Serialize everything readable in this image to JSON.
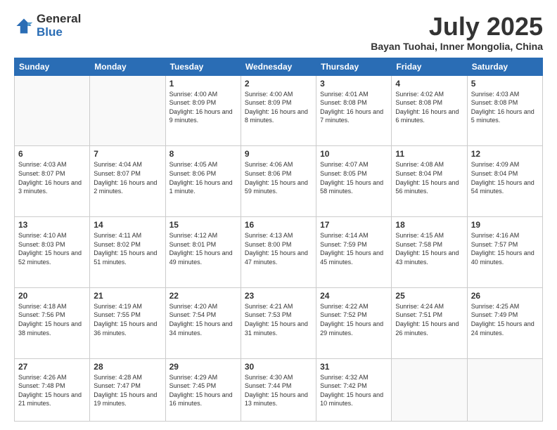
{
  "logo": {
    "general": "General",
    "blue": "Blue"
  },
  "header": {
    "title": "July 2025",
    "subtitle": "Bayan Tuohai, Inner Mongolia, China"
  },
  "weekdays": [
    "Sunday",
    "Monday",
    "Tuesday",
    "Wednesday",
    "Thursday",
    "Friday",
    "Saturday"
  ],
  "weeks": [
    [
      {
        "day": "",
        "info": ""
      },
      {
        "day": "",
        "info": ""
      },
      {
        "day": "1",
        "info": "Sunrise: 4:00 AM\nSunset: 8:09 PM\nDaylight: 16 hours\nand 9 minutes."
      },
      {
        "day": "2",
        "info": "Sunrise: 4:00 AM\nSunset: 8:09 PM\nDaylight: 16 hours\nand 8 minutes."
      },
      {
        "day": "3",
        "info": "Sunrise: 4:01 AM\nSunset: 8:08 PM\nDaylight: 16 hours\nand 7 minutes."
      },
      {
        "day": "4",
        "info": "Sunrise: 4:02 AM\nSunset: 8:08 PM\nDaylight: 16 hours\nand 6 minutes."
      },
      {
        "day": "5",
        "info": "Sunrise: 4:03 AM\nSunset: 8:08 PM\nDaylight: 16 hours\nand 5 minutes."
      }
    ],
    [
      {
        "day": "6",
        "info": "Sunrise: 4:03 AM\nSunset: 8:07 PM\nDaylight: 16 hours\nand 3 minutes."
      },
      {
        "day": "7",
        "info": "Sunrise: 4:04 AM\nSunset: 8:07 PM\nDaylight: 16 hours\nand 2 minutes."
      },
      {
        "day": "8",
        "info": "Sunrise: 4:05 AM\nSunset: 8:06 PM\nDaylight: 16 hours\nand 1 minute."
      },
      {
        "day": "9",
        "info": "Sunrise: 4:06 AM\nSunset: 8:06 PM\nDaylight: 15 hours\nand 59 minutes."
      },
      {
        "day": "10",
        "info": "Sunrise: 4:07 AM\nSunset: 8:05 PM\nDaylight: 15 hours\nand 58 minutes."
      },
      {
        "day": "11",
        "info": "Sunrise: 4:08 AM\nSunset: 8:04 PM\nDaylight: 15 hours\nand 56 minutes."
      },
      {
        "day": "12",
        "info": "Sunrise: 4:09 AM\nSunset: 8:04 PM\nDaylight: 15 hours\nand 54 minutes."
      }
    ],
    [
      {
        "day": "13",
        "info": "Sunrise: 4:10 AM\nSunset: 8:03 PM\nDaylight: 15 hours\nand 52 minutes."
      },
      {
        "day": "14",
        "info": "Sunrise: 4:11 AM\nSunset: 8:02 PM\nDaylight: 15 hours\nand 51 minutes."
      },
      {
        "day": "15",
        "info": "Sunrise: 4:12 AM\nSunset: 8:01 PM\nDaylight: 15 hours\nand 49 minutes."
      },
      {
        "day": "16",
        "info": "Sunrise: 4:13 AM\nSunset: 8:00 PM\nDaylight: 15 hours\nand 47 minutes."
      },
      {
        "day": "17",
        "info": "Sunrise: 4:14 AM\nSunset: 7:59 PM\nDaylight: 15 hours\nand 45 minutes."
      },
      {
        "day": "18",
        "info": "Sunrise: 4:15 AM\nSunset: 7:58 PM\nDaylight: 15 hours\nand 43 minutes."
      },
      {
        "day": "19",
        "info": "Sunrise: 4:16 AM\nSunset: 7:57 PM\nDaylight: 15 hours\nand 40 minutes."
      }
    ],
    [
      {
        "day": "20",
        "info": "Sunrise: 4:18 AM\nSunset: 7:56 PM\nDaylight: 15 hours\nand 38 minutes."
      },
      {
        "day": "21",
        "info": "Sunrise: 4:19 AM\nSunset: 7:55 PM\nDaylight: 15 hours\nand 36 minutes."
      },
      {
        "day": "22",
        "info": "Sunrise: 4:20 AM\nSunset: 7:54 PM\nDaylight: 15 hours\nand 34 minutes."
      },
      {
        "day": "23",
        "info": "Sunrise: 4:21 AM\nSunset: 7:53 PM\nDaylight: 15 hours\nand 31 minutes."
      },
      {
        "day": "24",
        "info": "Sunrise: 4:22 AM\nSunset: 7:52 PM\nDaylight: 15 hours\nand 29 minutes."
      },
      {
        "day": "25",
        "info": "Sunrise: 4:24 AM\nSunset: 7:51 PM\nDaylight: 15 hours\nand 26 minutes."
      },
      {
        "day": "26",
        "info": "Sunrise: 4:25 AM\nSunset: 7:49 PM\nDaylight: 15 hours\nand 24 minutes."
      }
    ],
    [
      {
        "day": "27",
        "info": "Sunrise: 4:26 AM\nSunset: 7:48 PM\nDaylight: 15 hours\nand 21 minutes."
      },
      {
        "day": "28",
        "info": "Sunrise: 4:28 AM\nSunset: 7:47 PM\nDaylight: 15 hours\nand 19 minutes."
      },
      {
        "day": "29",
        "info": "Sunrise: 4:29 AM\nSunset: 7:45 PM\nDaylight: 15 hours\nand 16 minutes."
      },
      {
        "day": "30",
        "info": "Sunrise: 4:30 AM\nSunset: 7:44 PM\nDaylight: 15 hours\nand 13 minutes."
      },
      {
        "day": "31",
        "info": "Sunrise: 4:32 AM\nSunset: 7:42 PM\nDaylight: 15 hours\nand 10 minutes."
      },
      {
        "day": "",
        "info": ""
      },
      {
        "day": "",
        "info": ""
      }
    ]
  ]
}
